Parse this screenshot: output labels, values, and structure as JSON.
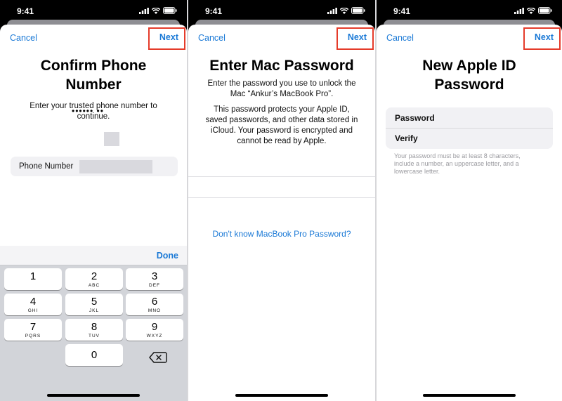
{
  "status_time": "9:41",
  "panels": [
    {
      "cancel": "Cancel",
      "next": "Next",
      "title_line1": "Confirm Phone",
      "title_line2": "Number",
      "instruction_line1": "Enter your trusted phone number to",
      "instruction_line2": "continue.",
      "masked_number": "•••••• ••",
      "field_label": "Phone Number",
      "done": "Done",
      "keys": [
        {
          "num": "1",
          "letters": ""
        },
        {
          "num": "2",
          "letters": "ABC"
        },
        {
          "num": "3",
          "letters": "DEF"
        },
        {
          "num": "4",
          "letters": "GHI"
        },
        {
          "num": "5",
          "letters": "JKL"
        },
        {
          "num": "6",
          "letters": "MNO"
        },
        {
          "num": "7",
          "letters": "PQRS"
        },
        {
          "num": "8",
          "letters": "TUV"
        },
        {
          "num": "9",
          "letters": "WXYZ"
        },
        {
          "num": "0",
          "letters": ""
        }
      ]
    },
    {
      "cancel": "Cancel",
      "next": "Next",
      "title": "Enter Mac Password",
      "line1": "Enter the password you use to unlock the",
      "line2": "Mac “Ankur’s MacBook Pro”.",
      "para2_line1": "This password protects your Apple ID,",
      "para2_line2": "saved passwords, and other data stored in",
      "para2_line3": "iCloud. Your password is encrypted and",
      "para2_line4": "cannot be read by Apple.",
      "link": "Don't know MacBook Pro Password?"
    },
    {
      "cancel": "Cancel",
      "next": "Next",
      "title_line1": "New Apple ID",
      "title_line2": "Password",
      "password_label": "Password",
      "verify_label": "Verify",
      "hint_line1": "Your password must be at least 8 characters,",
      "hint_line2": "include a number, an uppercase letter, and a",
      "hint_line3": "lowercase letter."
    }
  ],
  "colors": {
    "accent": "#1a79d6",
    "highlight": "#e53b2a"
  },
  "icons": [
    "signal-icon",
    "wifi-icon",
    "battery-icon",
    "delete-key-icon"
  ]
}
